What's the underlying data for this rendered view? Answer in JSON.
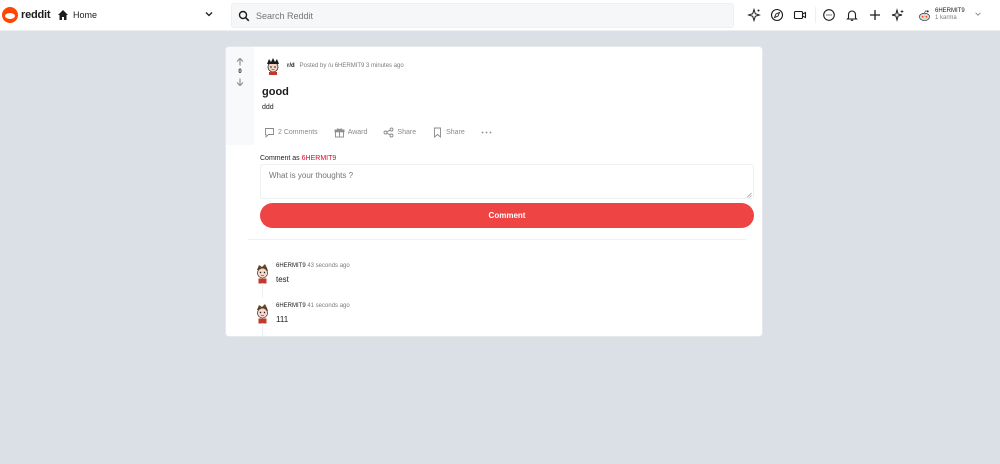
{
  "header": {
    "logo_text": "reddit",
    "home_label": "Home",
    "search_placeholder": "Search Reddit",
    "icons": [
      "popular-icon",
      "explore-icon",
      "video-icon",
      "chat-icon",
      "notification-icon",
      "create-post-icon",
      "advertise-icon"
    ],
    "user": {
      "name": "6HERMIT9",
      "karma": "1 karma"
    }
  },
  "post": {
    "score": "0",
    "subreddit": "r/d",
    "posted_by": "Posted by /u 6HERMIT9 3 minutes ago",
    "title": "good",
    "body": "ddd",
    "actions": {
      "comments": "2 Comments",
      "award": "Award",
      "share1": "Share",
      "share2": "Share"
    },
    "comment_as_prefix": "Comment as",
    "comment_as_user": "6HERMIT9",
    "comment_placeholder": "What is your thoughts ?",
    "comment_button": "Comment"
  },
  "comments": [
    {
      "author": "6HERMIT9",
      "time": "43 seconds ago",
      "text": "test"
    },
    {
      "author": "6HERMIT9",
      "time": "41 seconds ago",
      "text": "111"
    }
  ],
  "colors": {
    "accent": "#ef4444",
    "brand": "#ff4500",
    "username": "#ea0027",
    "background": "#dae0e6"
  }
}
